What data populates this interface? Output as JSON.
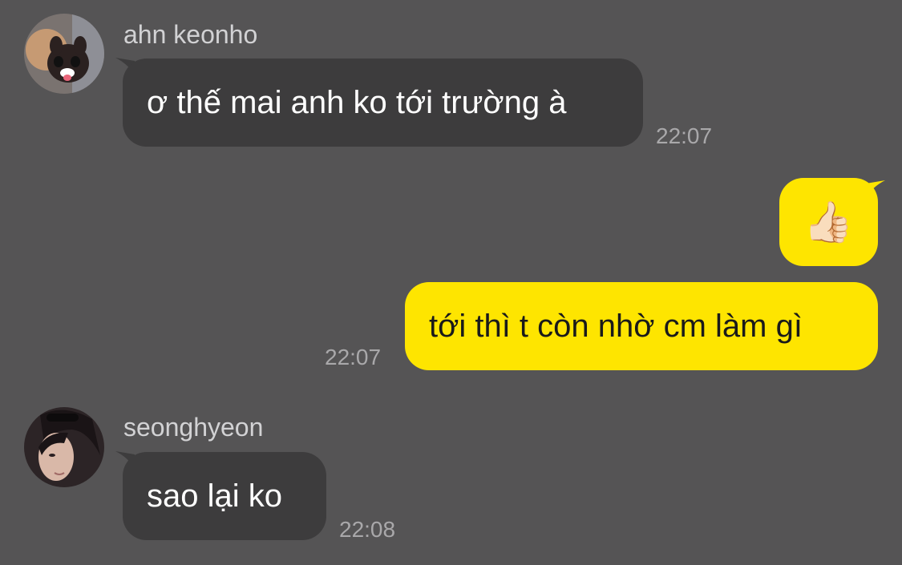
{
  "messages": [
    {
      "direction": "incoming",
      "sender": "ahn keonho",
      "avatar": "dog-photo-avatar",
      "text": "ơ thế mai anh ko tới trường à",
      "time": "22:07"
    },
    {
      "direction": "outgoing",
      "emoji": "👍🏻",
      "emoji_name": "thumbs-up-emoji"
    },
    {
      "direction": "outgoing",
      "text": "tới thì t còn nhờ cm làm gì",
      "time": "22:07"
    },
    {
      "direction": "incoming",
      "sender": "seonghyeon",
      "avatar": "person-photo-avatar",
      "text": "sao lại ko",
      "time": "22:08"
    }
  ],
  "colors": {
    "background": "#555455",
    "incoming_bubble": "#3d3c3d",
    "outgoing_bubble": "#fee500",
    "sender_name": "#d2d2d4",
    "timestamp": "#a9a8aa"
  }
}
